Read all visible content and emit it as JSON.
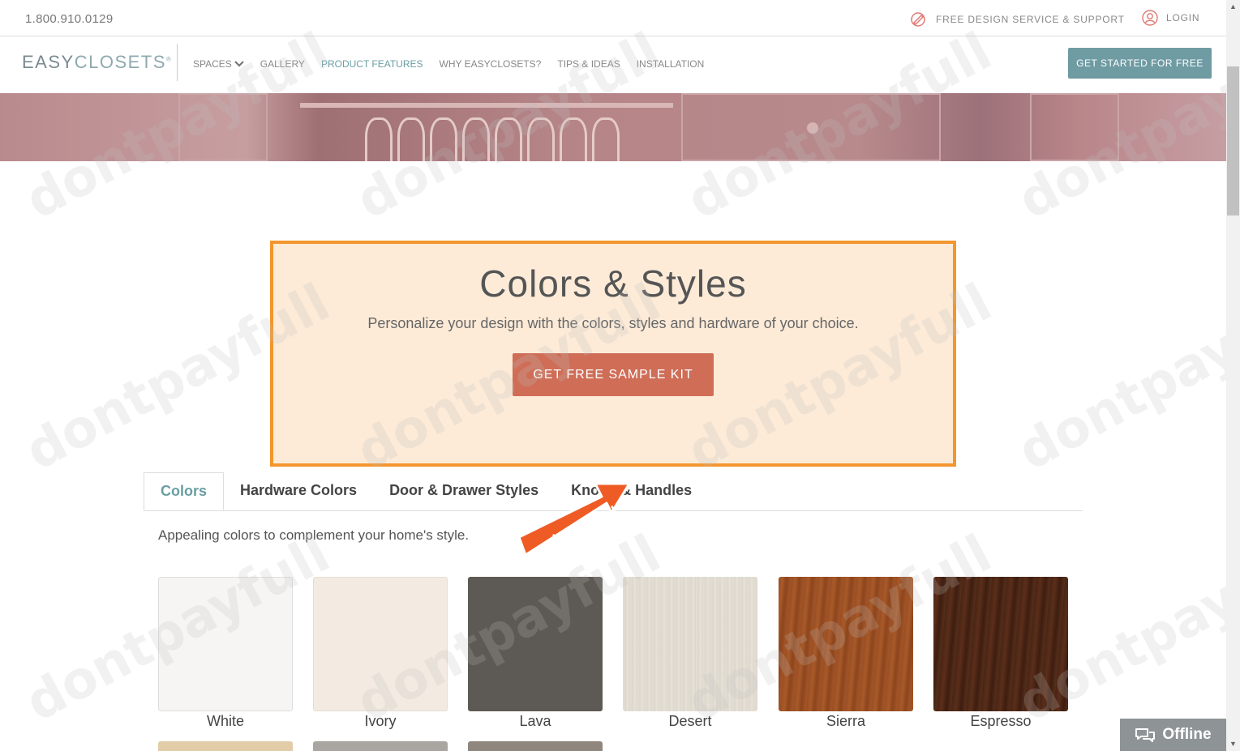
{
  "topbar": {
    "phone": "1.800.910.0129",
    "design_support": "FREE DESIGN SERVICE & SUPPORT",
    "login": "LOGIN"
  },
  "navbar": {
    "logo_part1": "EASY",
    "logo_part2": "CLOSETS",
    "items": [
      {
        "label": "SPACES"
      },
      {
        "label": "GALLERY"
      },
      {
        "label": "PRODUCT FEATURES"
      },
      {
        "label": "WHY EASYCLOSETS?"
      },
      {
        "label": "TIPS & IDEAS"
      },
      {
        "label": "INSTALLATION"
      }
    ],
    "cta": "GET STARTED FOR FREE"
  },
  "callout": {
    "title": "Colors & Styles",
    "subtitle": "Personalize your design with the colors, styles and hardware of your choice.",
    "button": "GET FREE SAMPLE KIT"
  },
  "tabs": [
    {
      "label": "Colors"
    },
    {
      "label": "Hardware Colors"
    },
    {
      "label": "Door & Drawer Styles"
    },
    {
      "label": "Knobs & Handles"
    }
  ],
  "description": "Appealing colors to complement your home's style.",
  "arrow_label": "dontpayfull",
  "swatches": [
    {
      "name": "White",
      "color": "#f6f5f3"
    },
    {
      "name": "Ivory",
      "color": "#f3ebe1"
    },
    {
      "name": "Lava",
      "color": "#5d5954"
    },
    {
      "name": "Desert",
      "color": "#e2ddd3"
    },
    {
      "name": "Sierra",
      "color": "#9a4e22"
    },
    {
      "name": "Espresso",
      "color": "#4a2414"
    }
  ],
  "swatches_row2": [
    {
      "color": "#e2cda8"
    },
    {
      "color": "#a9a5a0"
    },
    {
      "color": "#8f877e"
    }
  ],
  "chat": {
    "status": "Offline"
  },
  "watermark": "dontpayfull",
  "colors": {
    "accent": "#6a9ea3",
    "callout_border": "#f3962e",
    "callout_bg": "#fdebd8",
    "sample_button": "#cf6d57",
    "cta_button": "#6f9ba3"
  }
}
